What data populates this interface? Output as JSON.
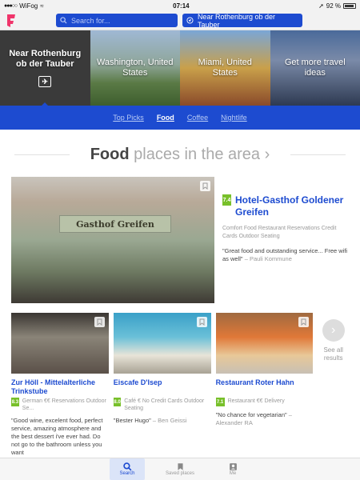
{
  "status": {
    "carrier": "WiFog",
    "time": "07:14",
    "battery": "92 %"
  },
  "search": {
    "placeholder": "Search for..."
  },
  "location_label": "Near Rothenburg ob der Tauber",
  "tiles": [
    {
      "label": "Near Rothenburg ob der Tauber"
    },
    {
      "label": "Washington, United States"
    },
    {
      "label": "Miami, United States"
    },
    {
      "label": "Get more travel ideas"
    }
  ],
  "nav": [
    "Top Picks",
    "Food",
    "Coffee",
    "Nightlife"
  ],
  "section": {
    "bold": "Food",
    "rest": "places in the area"
  },
  "featured": {
    "rating": "7.4",
    "name": "Hotel-Gasthof Goldener Greifen",
    "meta": "Comfort Food Restaurant  Reservations  Credit Cards  Outdoor Seating",
    "quote": "\"Great food and outstanding service... Free wifi as well\"",
    "by": "– Pauli Kommune",
    "sign": "Gasthof Greifen"
  },
  "cards": [
    {
      "name": "Zur Höll - Mittelalterliche Trinkstube",
      "rating": "8.3",
      "meta": "German  €€  Reservations  Outdoor Se...",
      "quote": "\"Good wine, excelent food, perfect service, amazing atmosphere and the best dessert i've ever had. Do not go to the bathroom unless you want",
      "by": ""
    },
    {
      "name": "Eiscafe D'Isep",
      "rating": "8.0",
      "meta": "Café  €  No Credit Cards  Outdoor Seating",
      "quote": "\"Bester Hugo\"",
      "by": "– Ben Geissi"
    },
    {
      "name": "Restaurant Roter Hahn",
      "rating": "7.1",
      "meta": "Restaurant  €€  Delivery",
      "quote": "\"No chance for vegetarian\"",
      "by": "– Alexander RA"
    }
  ],
  "see_all": "See all results",
  "tabs": [
    "Search",
    "Saved places",
    "Me"
  ],
  "colors": {
    "accent": "#1d4bd0",
    "rating": "#78c02a"
  }
}
